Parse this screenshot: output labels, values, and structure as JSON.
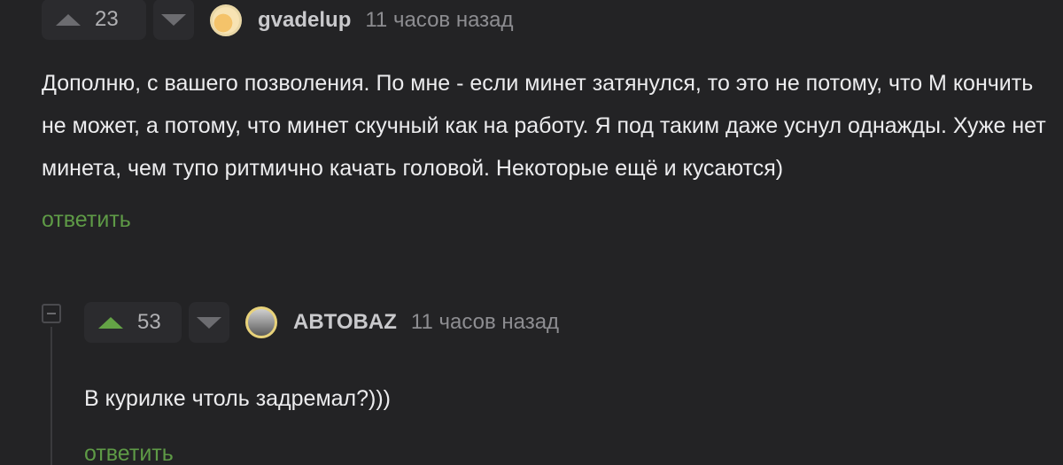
{
  "comments": [
    {
      "rating": "23",
      "username": "gvadelup",
      "time": "11 часов назад",
      "avatar_icon": "user-avatar-icon",
      "body": "Дополню, с вашего позволения. По мне - если минет затянулся, то это не потому, что М кончить не может, а потому, что минет скучный как на работу. Я под таким даже уснул однажды. Хуже нет минета, чем тупо ритмично качать головой. Некоторые ещё и кусаются)",
      "reply_label": "ответить",
      "upvoted": false
    },
    {
      "rating": "53",
      "username": "ABTOBAZ",
      "time": "11 часов назад",
      "avatar_icon": "user-avatar-icon",
      "body": "В курилке чтоль задремал?)))",
      "reply_label": "ответить",
      "upvoted": true
    }
  ],
  "colors": {
    "background": "#232325",
    "accent_green": "#64a346",
    "reply_green": "#5e9a46",
    "muted_text": "#8d8d91"
  }
}
